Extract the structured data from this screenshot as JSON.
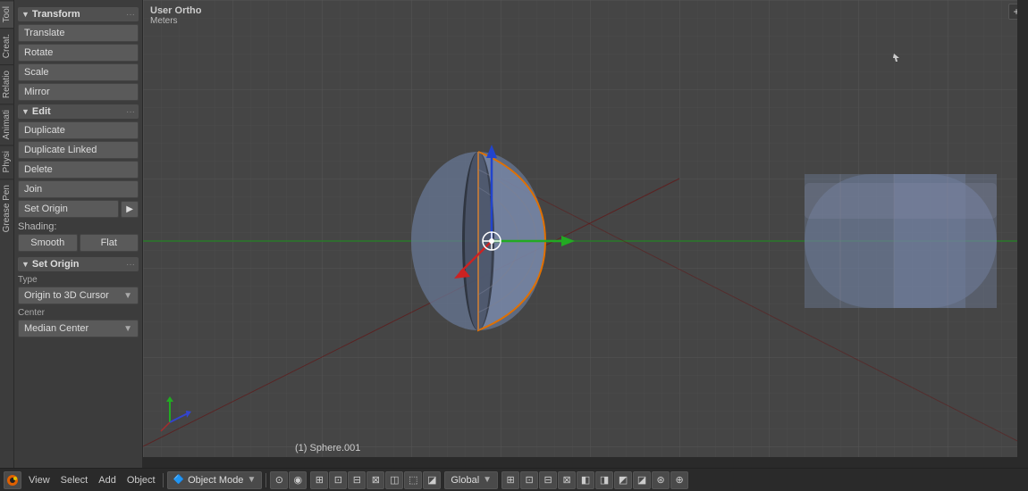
{
  "sidebar": {
    "tabs": [
      "Tool",
      "Creat.",
      "Relatio",
      "Animati",
      "Physi",
      "Grease Pen"
    ],
    "transform": {
      "header": "Transform",
      "buttons": [
        "Translate",
        "Rotate",
        "Scale",
        "Mirror"
      ]
    },
    "edit": {
      "header": "Edit",
      "buttons": [
        "Duplicate",
        "Duplicate Linked",
        "Delete",
        "Join"
      ],
      "set_origin": "Set Origin",
      "shading_label": "Shading:",
      "shading_buttons": [
        "Smooth",
        "Flat"
      ]
    },
    "set_origin_panel": {
      "header": "Set Origin",
      "type_label": "Type",
      "type_value": "Origin to 3D Cursor",
      "center_label": "Center",
      "center_value": "Median Center"
    }
  },
  "viewport": {
    "view_type": "User Ortho",
    "units": "Meters",
    "object_info": "(1) Sphere.001"
  },
  "statusbar": {
    "menu_items": [
      "View",
      "Select",
      "Add",
      "Object"
    ],
    "mode": "Object Mode",
    "transform_space": "Global",
    "corner_btn": "+"
  }
}
